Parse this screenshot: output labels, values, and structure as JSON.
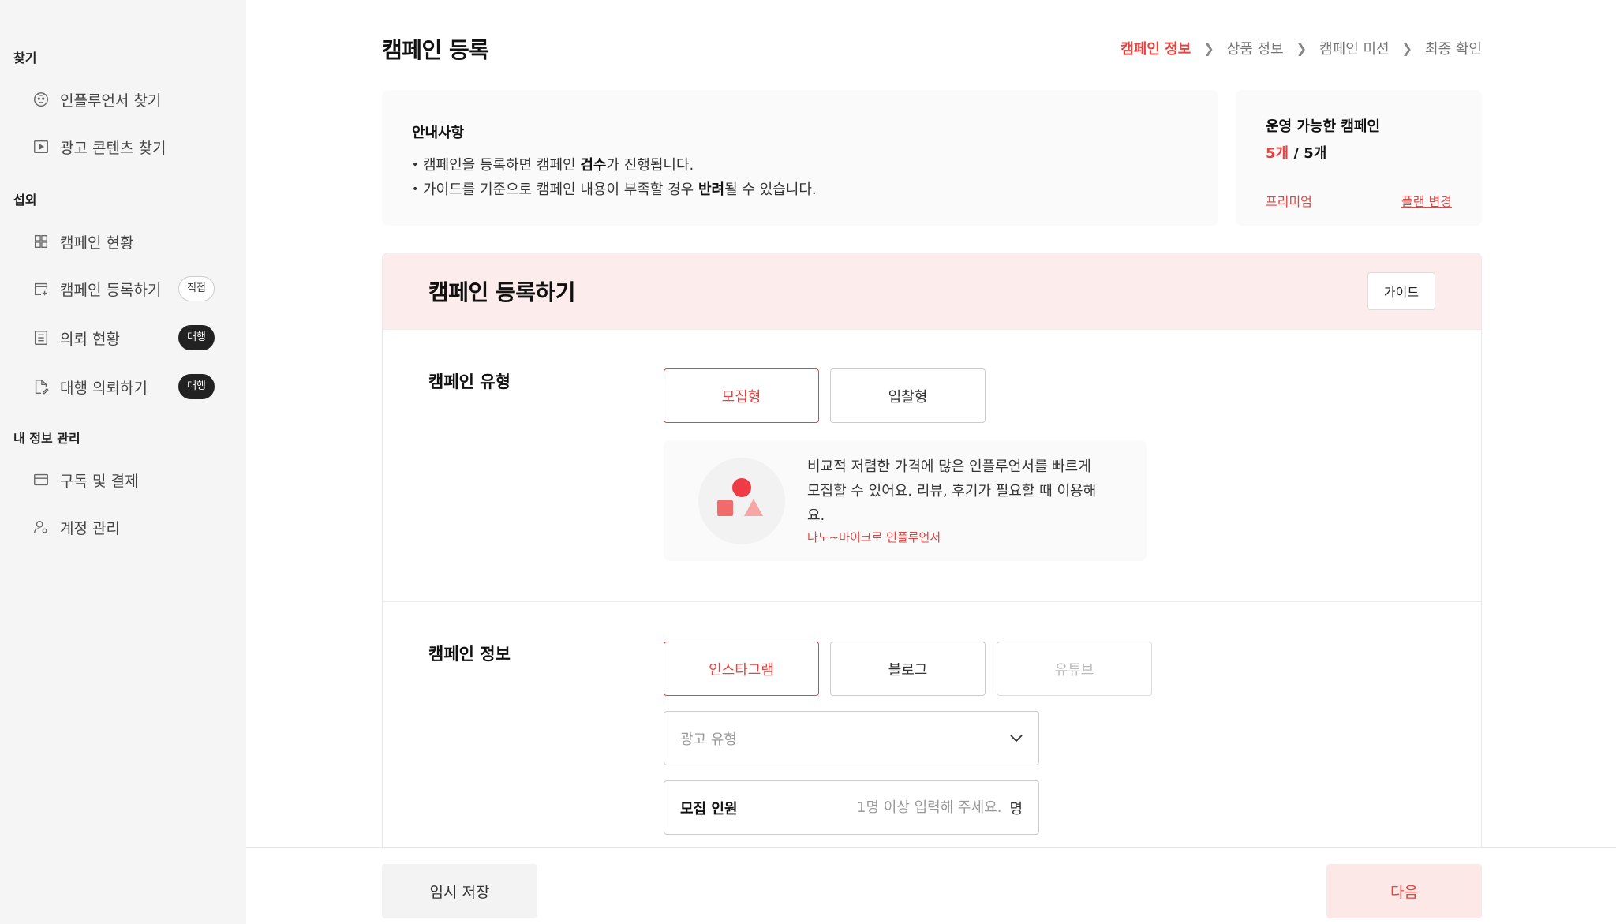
{
  "sidebar": {
    "sections": [
      {
        "title": "찾기",
        "items": [
          {
            "label": "인플루언서 찾기",
            "icon": "influencer-icon"
          },
          {
            "label": "광고 콘텐츠 찾기",
            "icon": "play-icon"
          }
        ]
      },
      {
        "title": "섭외",
        "items": [
          {
            "label": "캠페인 현황",
            "icon": "grid-icon"
          },
          {
            "label": "캠페인 등록하기",
            "icon": "calendar-plus-icon",
            "badge": "직접"
          },
          {
            "label": "의뢰 현황",
            "icon": "list-icon",
            "badge": "대행"
          },
          {
            "label": "대행 의뢰하기",
            "icon": "document-edit-icon",
            "badge": "대행"
          }
        ]
      },
      {
        "title": "내 정보 관리",
        "items": [
          {
            "label": "구독 및 결제",
            "icon": "card-icon"
          },
          {
            "label": "계정 관리",
            "icon": "user-settings-icon"
          }
        ]
      }
    ]
  },
  "header": {
    "title": "캠페인 등록",
    "steps": [
      "캠페인 정보",
      "상품 정보",
      "캠페인 미션",
      "최종 확인"
    ]
  },
  "notice": {
    "title": "안내사항",
    "line1": {
      "before": "캠페인을 등록하면 캠페인 ",
      "bold": "검수",
      "after": "가 진행됩니다."
    },
    "line2": {
      "before": "가이드를 기준으로 캠페인 내용이 부족할 경우 ",
      "bold": "반려",
      "after": "될 수 있습니다."
    }
  },
  "plan": {
    "title": "운영 가능한 캠페인",
    "used": "5개",
    "total": " / 5개",
    "tier": "프리미엄",
    "change_label": "플랜 변경"
  },
  "form": {
    "title": "캠페인 등록하기",
    "guide_label": "가이드",
    "type_section": {
      "label": "캠페인 유형",
      "options": [
        "모집형",
        "입찰형"
      ],
      "description_line1": "비교적 저렴한 가격에 많은 인플루언서를 빠르게",
      "description_line2": "모집할 수 있어요. 리뷰, 후기가 필요할 때 이용해요.",
      "description_sub": "나노~마이크로 인플루언서"
    },
    "info_section": {
      "label": "캠페인 정보",
      "platforms": [
        "인스타그램",
        "블로그",
        "유튜브"
      ],
      "ad_type_placeholder": "광고 유형",
      "recruit_label": "모집 인원",
      "recruit_placeholder": "1명 이상 입력해 주세요.",
      "recruit_unit": "명"
    }
  },
  "footer": {
    "save_label": "임시 저장",
    "next_label": "다음"
  },
  "colors": {
    "accent": "#e8413e",
    "accent_light": "#fdecec",
    "sidebar_bg": "#f5f5f5"
  }
}
